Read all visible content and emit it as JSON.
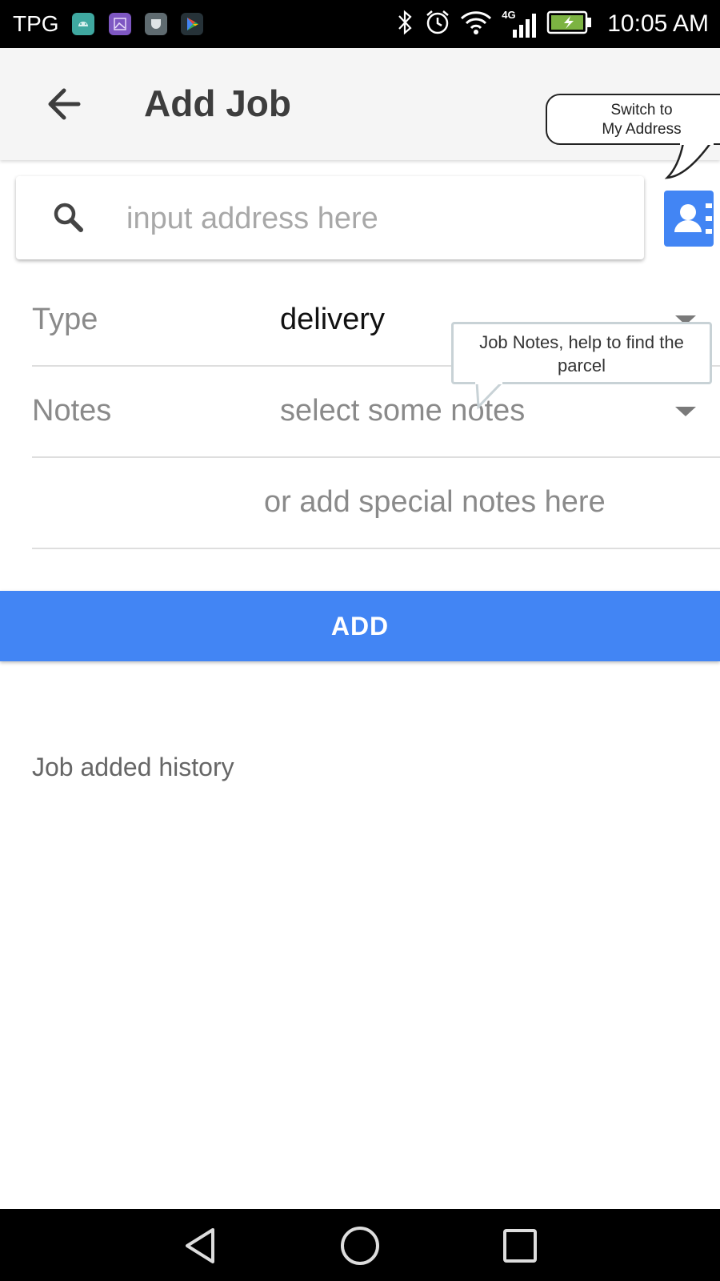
{
  "status_bar": {
    "carrier": "TPG",
    "network": "4G",
    "time": "10:05 AM",
    "notification_icons": [
      "android-icon",
      "gallery-icon",
      "shield-icon",
      "play-store-icon"
    ],
    "system_icons": [
      "bluetooth-icon",
      "alarm-icon",
      "wifi-icon",
      "signal-icon",
      "battery-charging-icon"
    ]
  },
  "app_bar": {
    "title": "Add Job",
    "back_icon": "arrow-back-icon"
  },
  "tooltip_contact": {
    "line1": "Switch to",
    "line2": "My Address"
  },
  "search": {
    "placeholder": "input address here",
    "value": "",
    "icon": "search-icon"
  },
  "contact_button": {
    "icon": "contact-book-icon",
    "color": "#4285f4"
  },
  "form": {
    "type_label": "Type",
    "type_value": "delivery",
    "notes_label": "Notes",
    "notes_placeholder": "select some notes",
    "special_notes_placeholder": "or add special notes here"
  },
  "tooltip_notes": {
    "line1": "Job Notes, help to find the",
    "line2": "parcel"
  },
  "add_button": {
    "label": "ADD",
    "color": "#4285f4"
  },
  "history": {
    "title": "Job added history"
  },
  "nav_bar": {
    "buttons": [
      "back-triangle-icon",
      "home-circle-icon",
      "recents-square-icon"
    ]
  }
}
